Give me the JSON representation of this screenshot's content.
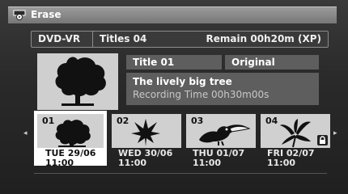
{
  "header": {
    "title": "Erase"
  },
  "info": {
    "disc_type": "DVD-VR",
    "titles": "Titles 04",
    "remain": "Remain  00h20m (XP)"
  },
  "preview": {
    "title": "Title 01",
    "type": "Original",
    "name": "The lively big tree",
    "recording_time": "Recording Time  00h30m00s"
  },
  "thumbnails": [
    {
      "number": "01",
      "date": "TUE 29/06",
      "time": "11:00",
      "selected": true,
      "locked": false,
      "image": "tree"
    },
    {
      "number": "02",
      "date": "WED 30/06",
      "time": "11:00",
      "selected": false,
      "locked": false,
      "image": "leaf"
    },
    {
      "number": "03",
      "date": "THU 01/07",
      "time": "11:00",
      "selected": false,
      "locked": false,
      "image": "toucan"
    },
    {
      "number": "04",
      "date": "FRI 02/07",
      "time": "11:00",
      "selected": false,
      "locked": true,
      "image": "lily"
    }
  ],
  "icons": {
    "title": "erase-disc-icon",
    "prev": "arrow-left-icon",
    "next": "arrow-right-icon",
    "lock": "lock-icon"
  },
  "arrows": {
    "left": "◂",
    "right": "▸"
  }
}
